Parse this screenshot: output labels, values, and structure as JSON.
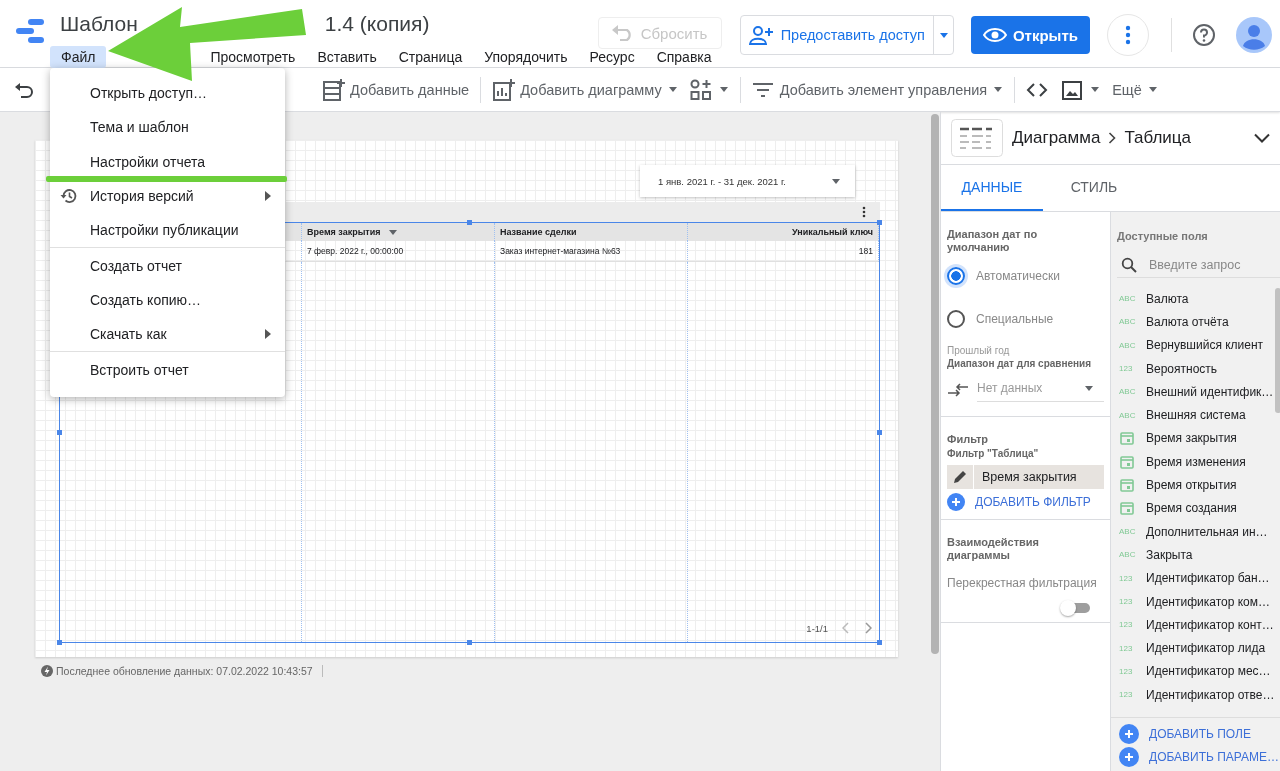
{
  "app": {
    "title_parts": [
      "Шаблон",
      "1.4 (копия)"
    ],
    "menu": [
      {
        "label": "Файл",
        "selected": true
      },
      {
        "label": "Просмотреть",
        "selected": false
      },
      {
        "label": "Вставить",
        "selected": false
      },
      {
        "label": "Страница",
        "selected": false
      },
      {
        "label": "Упорядочить",
        "selected": false
      },
      {
        "label": "Ресурс",
        "selected": false
      },
      {
        "label": "Справка",
        "selected": false
      }
    ]
  },
  "header_actions": {
    "reset": {
      "label": "Сбросить",
      "disabled": true
    },
    "share": {
      "label": "Предоставить доступ"
    },
    "open": {
      "label": "Открыть"
    }
  },
  "toolbar": [
    {
      "kind": "data",
      "label": "Добавить данные",
      "caret": false
    },
    {
      "kind": "chart",
      "label": "Добавить диаграмму",
      "caret": true
    },
    {
      "kind": "community",
      "caret": true
    },
    {
      "kind": "control",
      "label": "Добавить элемент управления",
      "caret": true
    },
    {
      "kind": "code",
      "caret": false
    },
    {
      "kind": "image",
      "caret": true
    },
    {
      "kind": "more",
      "label": "Ещё",
      "caret": true
    }
  ],
  "file_menu": [
    {
      "label": "Открыть доступ…",
      "kind": "plain",
      "submenu": false,
      "divider_before": false,
      "underlined": false
    },
    {
      "label": "Тема и шаблон",
      "kind": "plain",
      "submenu": false,
      "divider_before": false,
      "underlined": false
    },
    {
      "label": "Настройки отчета",
      "kind": "plain",
      "submenu": false,
      "divider_before": false,
      "underlined": true
    },
    {
      "label": "История версий",
      "kind": "history",
      "submenu": true,
      "divider_before": false,
      "underlined": false
    },
    {
      "label": "Настройки публикации",
      "kind": "plain",
      "submenu": false,
      "divider_before": false,
      "underlined": false
    },
    {
      "label": "Создать отчет",
      "kind": "plain",
      "submenu": false,
      "divider_before": true,
      "underlined": false
    },
    {
      "label": "Создать копию…",
      "kind": "plain",
      "submenu": false,
      "divider_before": false,
      "underlined": false
    },
    {
      "label": "Скачать как",
      "kind": "plain",
      "submenu": true,
      "divider_before": false,
      "underlined": false
    },
    {
      "label": "Встроить отчет",
      "kind": "plain",
      "submenu": false,
      "divider_before": true,
      "underlined": false
    }
  ],
  "canvas": {
    "date_range": "1 янв. 2021 г. - 31 дек. 2021 г.",
    "table": {
      "columns": [
        {
          "label": "Время закрытия",
          "sorted": true
        },
        {
          "label": "Название сделки",
          "sorted": false
        },
        {
          "label": "Уникальный ключ",
          "sorted": false
        }
      ],
      "rows": [
        [
          "7 февр. 2022 г., 00:00:00",
          "Заказ интернет-магазина №63",
          "181"
        ]
      ],
      "pagination": "1-1/1"
    },
    "footer": "Последнее обновление данных: 07.02.2022 10:43:57"
  },
  "panel": {
    "breadcrumb": [
      "Диаграмма",
      "Таблица"
    ],
    "tabs": [
      {
        "label": "ДАННЫЕ",
        "selected": true
      },
      {
        "label": "СТИЛЬ",
        "selected": false
      }
    ],
    "date_section": {
      "title": "Диапазон дат по умолчанию",
      "options": [
        {
          "label": "Автоматически",
          "selected": true
        },
        {
          "label": "Специальные",
          "selected": false
        }
      ],
      "compare_hint": "Прошлый год",
      "compare_title": "Диапазон дат для сравнения",
      "compare_value": "Нет данных"
    },
    "filter": {
      "title": "Фильтр",
      "subtitle": "Фильтр \"Таблица\"",
      "chip": "Время закрытия",
      "add": "ДОБАВИТЬ ФИЛЬТР"
    },
    "interactions": {
      "title": "Взаимодействия диаграммы",
      "cross_filter": {
        "label": "Перекрестная фильтрация",
        "on": false
      }
    },
    "fields": {
      "title": "Доступные поля",
      "placeholder": "Введите запрос",
      "items": [
        {
          "kind": "text",
          "badge": "ABC",
          "label": "Валюта"
        },
        {
          "kind": "text",
          "badge": "ABC",
          "label": "Валюта отчёта"
        },
        {
          "kind": "text",
          "badge": "ABC",
          "label": "Вернувшийся клиент"
        },
        {
          "kind": "number",
          "badge": "123",
          "label": "Вероятность"
        },
        {
          "kind": "text",
          "badge": "ABC",
          "label": "Внешний идентифик…"
        },
        {
          "kind": "text",
          "badge": "ABC",
          "label": "Внешняя система"
        },
        {
          "kind": "date",
          "label": "Время закрытия"
        },
        {
          "kind": "date",
          "label": "Время изменения"
        },
        {
          "kind": "date",
          "label": "Время открытия"
        },
        {
          "kind": "date",
          "label": "Время создания"
        },
        {
          "kind": "text",
          "badge": "ABC",
          "label": "Дополнительная ин…"
        },
        {
          "kind": "text",
          "badge": "ABC",
          "label": "Закрыта"
        },
        {
          "kind": "number",
          "badge": "123",
          "label": "Идентификатор бан…"
        },
        {
          "kind": "number",
          "badge": "123",
          "label": "Идентификатор ком…"
        },
        {
          "kind": "number",
          "badge": "123",
          "label": "Идентификатор конт…"
        },
        {
          "kind": "number",
          "badge": "123",
          "label": "Идентификатор лида"
        },
        {
          "kind": "number",
          "badge": "123",
          "label": "Идентификатор мес…"
        },
        {
          "kind": "number",
          "badge": "123",
          "label": "Идентификатор отве…"
        }
      ],
      "add_buttons": [
        "ДОБАВИТЬ ПОЛЕ",
        "ДОБАВИТЬ ПАРАМЕ…"
      ]
    }
  }
}
